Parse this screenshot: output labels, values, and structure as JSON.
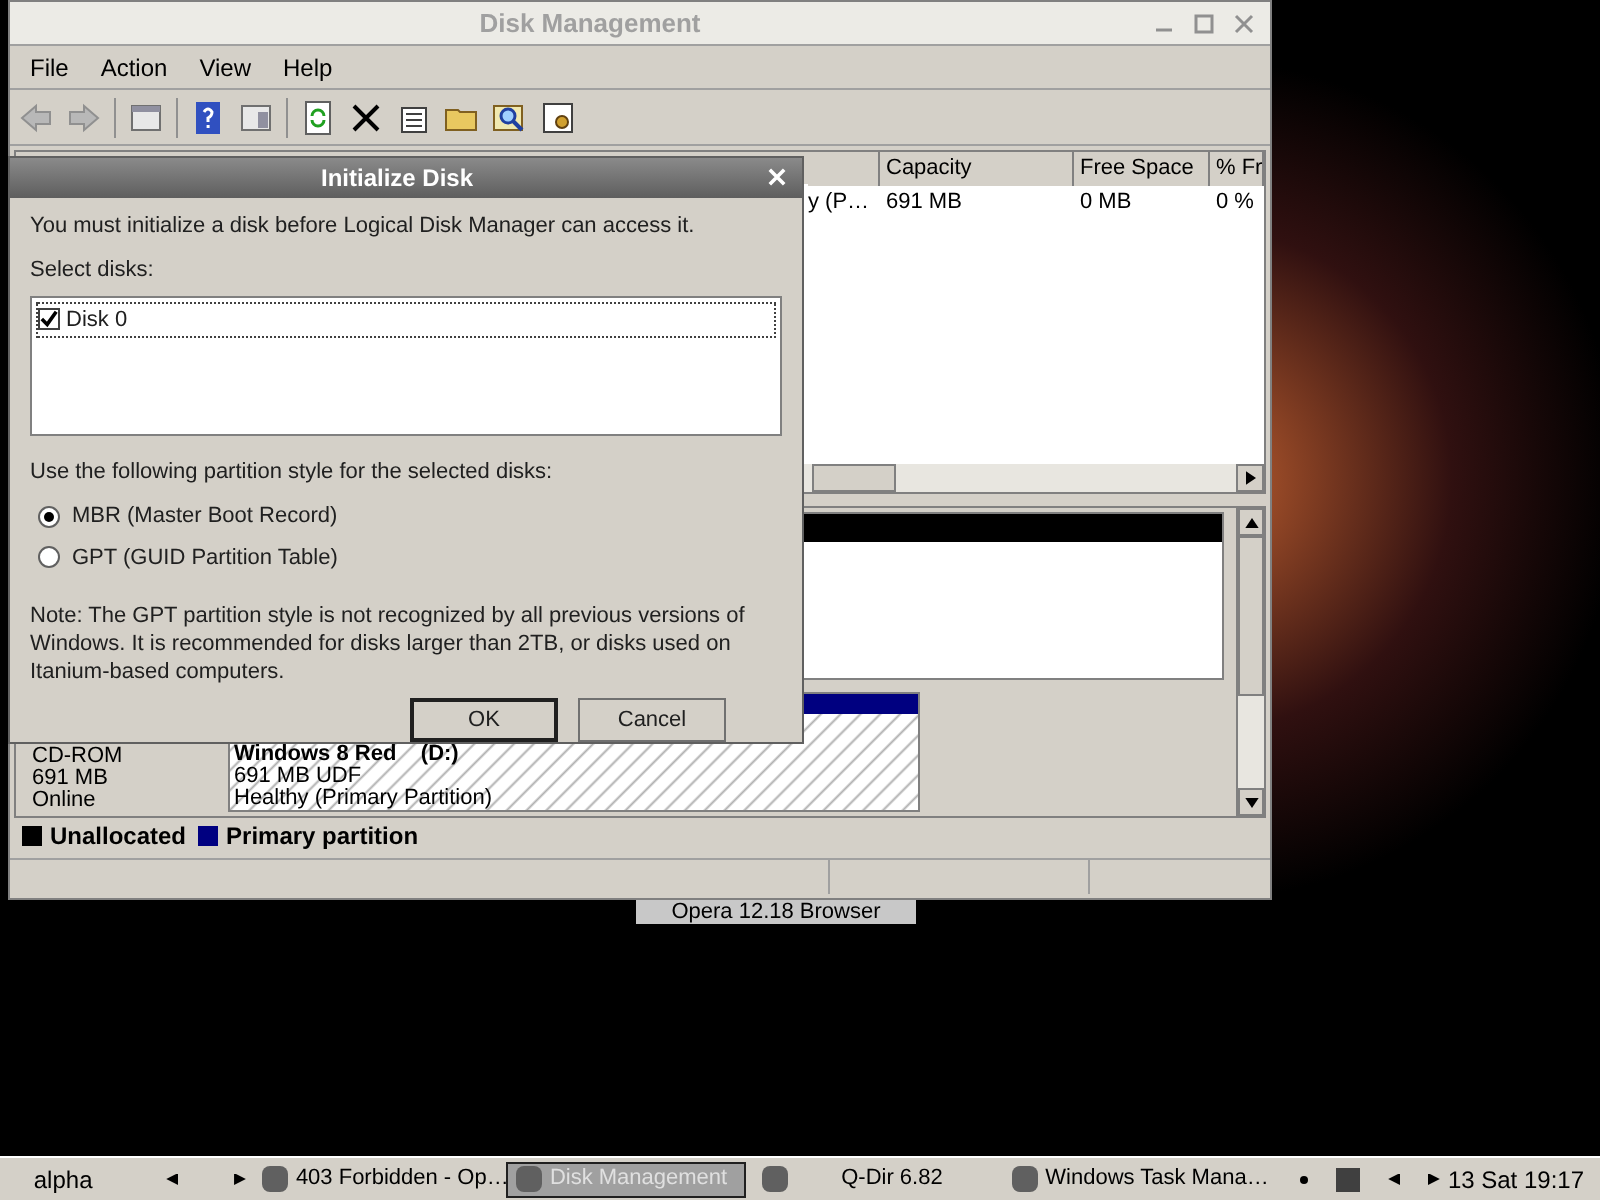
{
  "window": {
    "title": "Disk Management",
    "menu": [
      "File",
      "Action",
      "View",
      "Help"
    ]
  },
  "volume_table": {
    "columns": [
      "Capacity",
      "Free Space",
      "% Fr"
    ],
    "rows": [
      {
        "column_1": "y (P…",
        "cells": [
          "691 MB",
          "0 MB",
          "0 %"
        ]
      }
    ]
  },
  "disks": [
    {
      "lines": [
        "CD-ROM",
        "691 MB",
        "Online"
      ],
      "volume": {
        "name": "Windows 8 Red",
        "letter": "(D:)",
        "lines": [
          "691 MB UDF",
          "Healthy (Primary Partition)"
        ]
      }
    }
  ],
  "legend": [
    {
      "label": "Unallocated",
      "color": "#000000"
    },
    {
      "label": "Primary partition",
      "color": "#000080"
    }
  ],
  "dialog": {
    "title": "Initialize Disk",
    "intro": "You must initialize a disk before Logical Disk Manager can access it.",
    "select_label": "Select disks:",
    "disks": [
      {
        "label": "Disk 0",
        "checked": true
      }
    ],
    "style_label": "Use the following partition style for the selected disks:",
    "styles": [
      {
        "label": "MBR (Master Boot Record)",
        "selected": true
      },
      {
        "label": "GPT (GUID Partition Table)",
        "selected": false
      }
    ],
    "note": "Note: The GPT partition style is not recognized by all previous versions of Windows. It is recommended for disks larger than 2TB, or disks used on Itanium-based computers.",
    "buttons": [
      "OK",
      "Cancel"
    ]
  },
  "tooltip": "Opera 12.18 Browser",
  "taskbar": {
    "start": "alpha",
    "tasks": [
      {
        "label": "403 Forbidden - Op…",
        "selected": false
      },
      {
        "label": "Disk Management",
        "selected": true
      },
      {
        "label": "Q-Dir 6.82",
        "selected": false
      },
      {
        "label": "Windows Task Mana…",
        "selected": false
      }
    ],
    "clock": "13 Sat 19:17"
  }
}
